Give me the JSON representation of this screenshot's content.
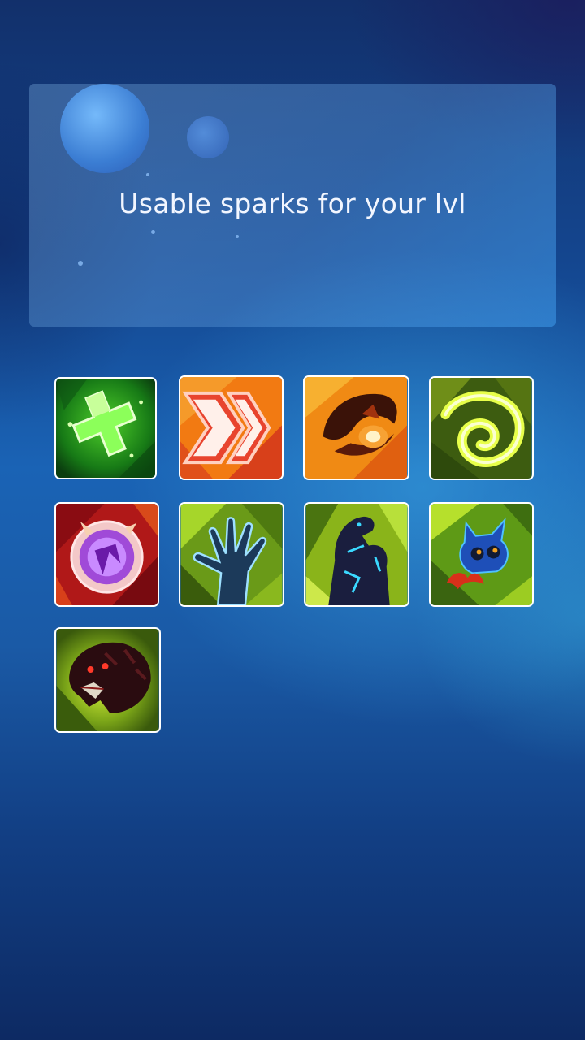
{
  "header": {
    "title": "Usable sparks for your lvl"
  },
  "sparks": [
    {
      "icon": "green-cross-heal-icon"
    },
    {
      "icon": "speed-chevrons-icon"
    },
    {
      "icon": "fire-claw-icon"
    },
    {
      "icon": "yellow-spiral-icon"
    },
    {
      "icon": "purple-orb-shield-icon"
    },
    {
      "icon": "dark-hand-icon"
    },
    {
      "icon": "shadow-beast-arm-icon"
    },
    {
      "icon": "blue-creature-icon"
    },
    {
      "icon": "red-eyed-panther-icon"
    }
  ],
  "colors": {
    "panel_text": "#f2f6ff",
    "tile_border": "#ffffff"
  }
}
